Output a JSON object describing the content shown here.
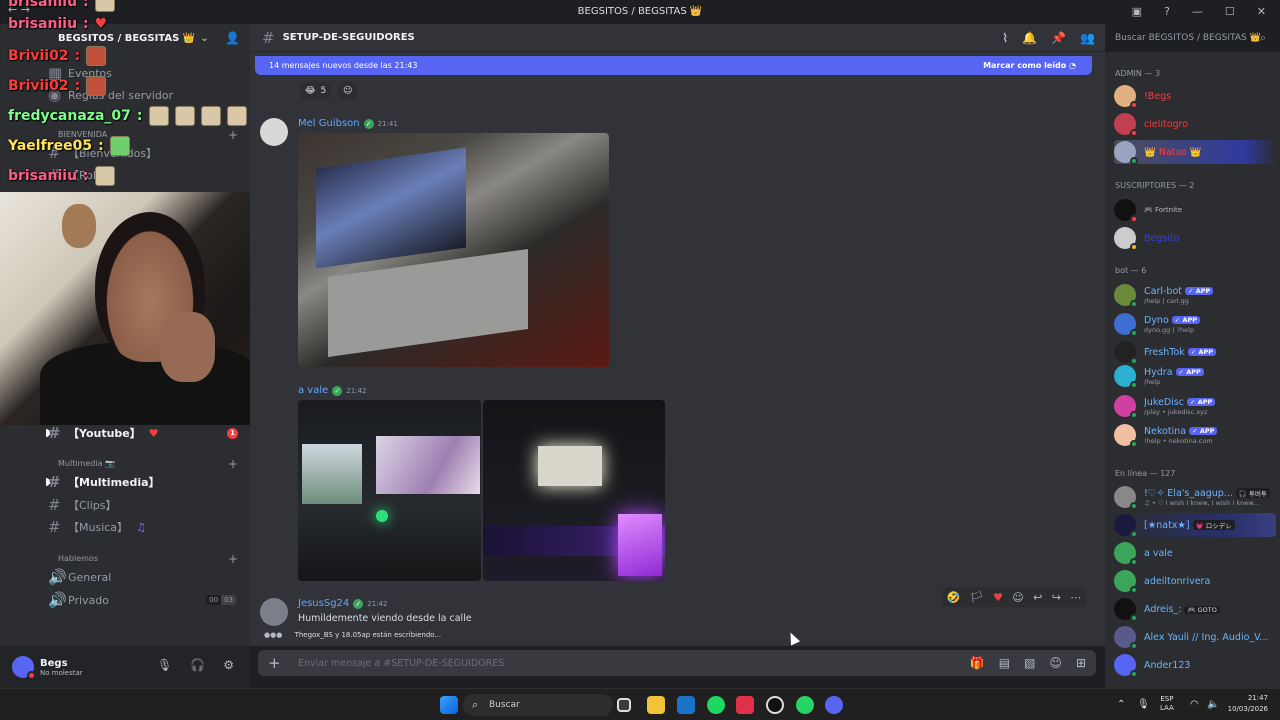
{
  "titlebar": {
    "title": "BEGSITOS / BEGSITAS 👑"
  },
  "server": {
    "name": "BEGSITOS / BEGSITAS 👑"
  },
  "sidebar": {
    "events": "Eventos",
    "rules": "Reglas del servidor",
    "category_welcome": "BIENVENIDA",
    "welcome_channel": "【Bienvenidos】",
    "roles_channel": "【Roles】",
    "youtube_channel": "【Youtube】",
    "youtube_badge": "1",
    "category_media": "Multimedia 📷",
    "multimedia_channel": "【Multimedia】",
    "clips_channel": "【Clips】",
    "music_channel": "【Musica】",
    "category_talk": "Hablemos",
    "voice_general": "General",
    "voice_private": "Privado",
    "voice_private_count_a": "00",
    "voice_private_count_b": "03"
  },
  "user": {
    "name": "Begs",
    "status": "No molestar"
  },
  "overlay": {
    "lines": [
      {
        "user": "brisaniiu",
        "text": ":"
      },
      {
        "user": "brisaniiu",
        "text": ":"
      },
      {
        "user": "Brivii02",
        "text": ":"
      },
      {
        "user": "Brivii02",
        "text": ":"
      },
      {
        "user": "fredycanaza_07",
        "text": ":"
      },
      {
        "user": "Yaelfree05",
        "text": ":"
      },
      {
        "user": "brisaniiu",
        "text": ":"
      }
    ]
  },
  "channel": {
    "name": "SETUP-DE-SEGUIDORES"
  },
  "search": {
    "placeholder": "Buscar BEGSITOS / BEGSITAS 👑"
  },
  "newbar": {
    "text": "14 mensajes nuevos desde las 21:43",
    "mark": "Marcar como leído"
  },
  "messages": {
    "reaction_count": "5",
    "m1": {
      "author": "Mel Guibson",
      "time": "21:41"
    },
    "m2": {
      "author": "a vale",
      "time": "21:42"
    },
    "m3": {
      "author": "JesusSg24",
      "time": "21:42",
      "text": "Humildemente viendo desde la calle"
    }
  },
  "typing": {
    "text": "Thegox_BS y 18.05ap están escribiendo..."
  },
  "composer": {
    "placeholder": "Enviar mensaje a #SETUP-DE-SEGUIDORES"
  },
  "members": {
    "admin_header": "ADMIN — 3",
    "admins": [
      "!Begs",
      "cielitogro",
      "👑 Natxo 👑"
    ],
    "subs_header": "SUSCRIPTORES — 2",
    "sub1_activity": "Fortnite",
    "sub2": "Begsito",
    "bot_header": "bot — 6",
    "bots": [
      {
        "name": "Carl-bot",
        "sub": "/help | carl.gg"
      },
      {
        "name": "Dyno",
        "sub": "dyno.gg | ?help"
      },
      {
        "name": "FreshTok",
        "sub": ""
      },
      {
        "name": "Hydra",
        "sub": "/help"
      },
      {
        "name": "JukeDisc",
        "sub": "/play • jukedisc.xyz"
      },
      {
        "name": "Nekotina",
        "sub": "!help • nekotina.com"
      }
    ],
    "app_tag": "APP",
    "online_header": "En línea — 127",
    "online": [
      {
        "name": "!♡✧ Ela's_aagup...",
        "tag": "🎧 투버투",
        "sub": "♫ • ♡ I wish I knew, I wish I knew..."
      },
      {
        "name": "[★natx★]",
        "tag": "💗 ロシデレ",
        "sub": ""
      },
      {
        "name": "a vale",
        "tag": "",
        "sub": ""
      },
      {
        "name": "adeiltonrivera",
        "tag": "",
        "sub": ""
      },
      {
        "name": "Adreis_:",
        "tag": "🎮 GOTO",
        "sub": ""
      },
      {
        "name": "Alex Yauli // Ing. Audio_V...",
        "tag": "",
        "sub": ""
      },
      {
        "name": "Ander123",
        "tag": "",
        "sub": ""
      }
    ]
  },
  "taskbar": {
    "search": "Buscar",
    "lang": "ESP",
    "lang2": "LAA",
    "time": "21:47",
    "date": "10/03/2026"
  },
  "colors": {
    "blurple": "#5865f2",
    "admin_red": "#f23f43",
    "bg_chat": "#313338",
    "bg_sidebar": "#2b2d31"
  }
}
